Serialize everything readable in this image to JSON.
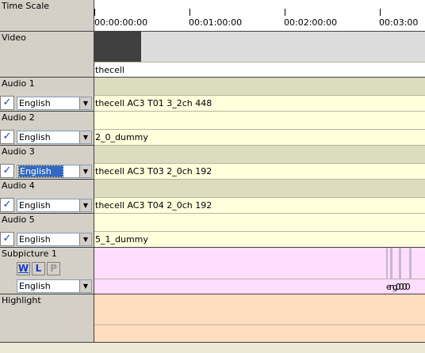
{
  "labels": {
    "timescale": "Time Scale",
    "video": "Video",
    "audio1": "Audio 1",
    "audio2": "Audio 2",
    "audio3": "Audio 3",
    "audio4": "Audio 4",
    "audio5": "Audio 5",
    "subpicture1": "Subpicture 1",
    "highlight": "Highlight"
  },
  "ruler": [
    "00:00:00:00",
    "00:01:00:00",
    "00:02:00:00",
    "00:03:00"
  ],
  "video_clip": "thecell",
  "audio": [
    {
      "lang": "English",
      "clip": "thecell AC3 T01 3_2ch 448",
      "checked": "✓"
    },
    {
      "lang": "English",
      "clip": "2_0_dummy",
      "checked": "✓"
    },
    {
      "lang": "English",
      "clip": "thecell AC3 T03 2_0ch 192",
      "checked": "✓"
    },
    {
      "lang": "English",
      "clip": "thecell AC3 T04 2_0ch 192",
      "checked": "✓"
    },
    {
      "lang": "English",
      "clip": "5_1_dummy",
      "checked": "✓"
    }
  ],
  "subpicture": {
    "lang": "English",
    "buttons": {
      "w": "W",
      "l": "L",
      "p": "P"
    },
    "clip_text": "eng0000"
  },
  "colors": {
    "panel": "#d4d0c8",
    "audio_top": "#dcdcbf",
    "audio_bottom": "#ffffdc",
    "subpicture": "#ffddff",
    "highlight": "#ffddbf",
    "video_band": "#dcdcdc",
    "video_clip": "#404040",
    "select_highlight": "#316ac5",
    "check_color": "#1a3acb"
  }
}
